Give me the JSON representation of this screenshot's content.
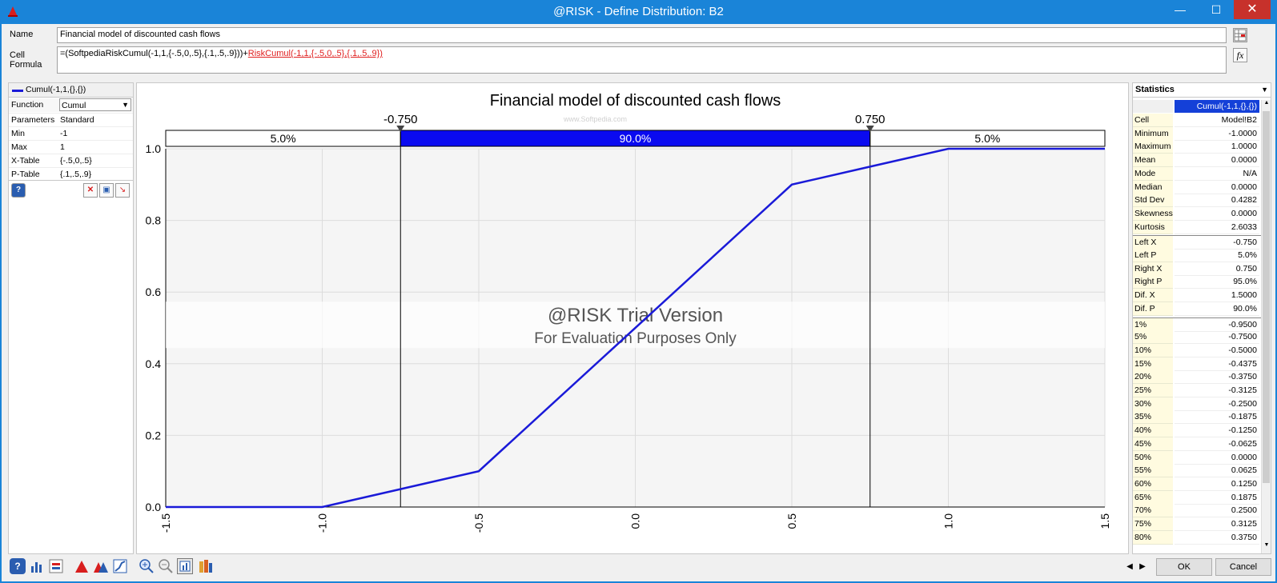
{
  "window": {
    "title": "@RISK - Define Distribution: B2",
    "minimize": "—",
    "maximize": "☐",
    "close": "✕"
  },
  "header": {
    "name_label": "Name",
    "name_value": "Financial model of discounted cash flows",
    "cell_formula_label_1": "Cell",
    "cell_formula_label_2": "Formula",
    "formula_prefix": "=(SoftpediaRiskCumul(-1,1,{-.5,0,.5},{.1,.5,.9}))+",
    "formula_link": "RiskCumul(-1,1,{-.5,0,.5},{.1,.5,.9})"
  },
  "left_panel": {
    "legend": "Cumul(-1,1,{},{})",
    "function_label": "Function",
    "function_value": "Cumul",
    "params": [
      {
        "k": "Parameters",
        "v": "Standard"
      },
      {
        "k": "Min",
        "v": "-1"
      },
      {
        "k": "Max",
        "v": "1"
      },
      {
        "k": "X-Table",
        "v": "{-.5,0,.5}"
      },
      {
        "k": "P-Table",
        "v": "{.1,.5,.9}"
      }
    ]
  },
  "chart_data": {
    "type": "line",
    "title": "Financial model of discounted cash flows",
    "x": [
      -1.5,
      -1.0,
      -0.75,
      -0.5,
      0.5,
      0.75,
      1.0,
      1.5
    ],
    "series": [
      {
        "values": [
          0.0,
          0.0,
          0.05,
          0.1,
          0.9,
          0.95,
          1.0,
          1.0
        ],
        "color": "#1a1ad8"
      }
    ],
    "xlim": [
      -1.5,
      1.5
    ],
    "ylim": [
      0.0,
      1.0
    ],
    "xticks": [
      "-1.5",
      "-1.0",
      "-0.5",
      "0.0",
      "0.5",
      "1.0",
      "1.5"
    ],
    "yticks": [
      "0.0",
      "0.2",
      "0.4",
      "0.6",
      "0.8",
      "1.0"
    ],
    "grid": true,
    "delimiters": {
      "left_x": -0.75,
      "right_x": 0.75,
      "left_label": "-0.750",
      "right_label": "0.750",
      "bands": [
        "5.0%",
        "90.0%",
        "5.0%"
      ]
    },
    "watermark_1": "@RISK Trial Version",
    "watermark_2": "For Evaluation Purposes Only",
    "watermark_small": "www.Softpedia.com"
  },
  "stats": {
    "header": "Statistics",
    "column": "Cumul(-1,1,{},{})",
    "rows": [
      {
        "k": "Cell",
        "v": "Model!B2"
      },
      {
        "k": "Minimum",
        "v": "-1.0000"
      },
      {
        "k": "Maximum",
        "v": "1.0000"
      },
      {
        "k": "Mean",
        "v": "0.0000"
      },
      {
        "k": "Mode",
        "v": "N/A"
      },
      {
        "k": "Median",
        "v": "0.0000"
      },
      {
        "k": "Std Dev",
        "v": "0.4282"
      },
      {
        "k": "Skewness",
        "v": "0.0000"
      },
      {
        "k": "Kurtosis",
        "v": "2.6033"
      },
      {
        "k": "Left X",
        "v": "-0.750"
      },
      {
        "k": "Left P",
        "v": "5.0%"
      },
      {
        "k": "Right X",
        "v": "0.750"
      },
      {
        "k": "Right P",
        "v": "95.0%"
      },
      {
        "k": "Dif. X",
        "v": "1.5000"
      },
      {
        "k": "Dif. P",
        "v": "90.0%"
      },
      {
        "k": "1%",
        "v": "-0.9500"
      },
      {
        "k": "5%",
        "v": "-0.7500"
      },
      {
        "k": "10%",
        "v": "-0.5000"
      },
      {
        "k": "15%",
        "v": "-0.4375"
      },
      {
        "k": "20%",
        "v": "-0.3750"
      },
      {
        "k": "25%",
        "v": "-0.3125"
      },
      {
        "k": "30%",
        "v": "-0.2500"
      },
      {
        "k": "35%",
        "v": "-0.1875"
      },
      {
        "k": "40%",
        "v": "-0.1250"
      },
      {
        "k": "45%",
        "v": "-0.0625"
      },
      {
        "k": "50%",
        "v": "0.0000"
      },
      {
        "k": "55%",
        "v": "0.0625"
      },
      {
        "k": "60%",
        "v": "0.1250"
      },
      {
        "k": "65%",
        "v": "0.1875"
      },
      {
        "k": "70%",
        "v": "0.2500"
      },
      {
        "k": "75%",
        "v": "0.3125"
      },
      {
        "k": "80%",
        "v": "0.3750"
      }
    ]
  },
  "footer": {
    "ok": "OK",
    "cancel": "Cancel"
  }
}
